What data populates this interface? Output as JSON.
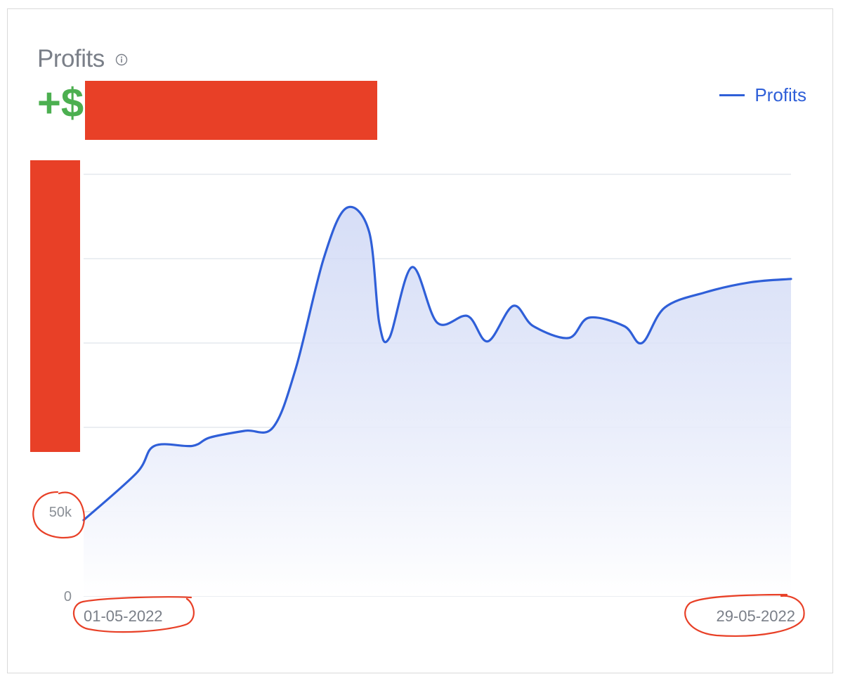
{
  "header": {
    "title": "Profits",
    "value_prefix": "+$",
    "info_icon": "info-icon"
  },
  "legend": {
    "label": "Profits"
  },
  "colors": {
    "line": "#2f5fd8",
    "fill_top": "#c9d3f4",
    "grid": "#dfe3ea",
    "value": "#4caf50",
    "annotation": "#e84027"
  },
  "chart_data": {
    "type": "area",
    "title": "",
    "xlabel": "",
    "ylabel": "",
    "ylim": [
      0,
      250000
    ],
    "y_ticks": [
      {
        "label": "0",
        "value": 0
      },
      {
        "label": "50k",
        "value": 50000
      }
    ],
    "grid_values": [
      0,
      50000,
      100000,
      150000,
      200000,
      250000
    ],
    "x_tick_labels": [
      "01-05-2022",
      "29-05-2022"
    ],
    "x_domain": [
      0,
      28
    ],
    "series": [
      {
        "name": "Profits",
        "points": [
          [
            0.0,
            45000
          ],
          [
            2.1,
            73000
          ],
          [
            2.8,
            89000
          ],
          [
            4.3,
            89000
          ],
          [
            5.0,
            94000
          ],
          [
            6.4,
            98000
          ],
          [
            7.5,
            100000
          ],
          [
            8.4,
            135000
          ],
          [
            9.5,
            200000
          ],
          [
            10.4,
            230000
          ],
          [
            11.3,
            216000
          ],
          [
            11.7,
            162000
          ],
          [
            12.1,
            153000
          ],
          [
            13.0,
            195000
          ],
          [
            14.0,
            162000
          ],
          [
            15.2,
            166000
          ],
          [
            16.0,
            151000
          ],
          [
            17.0,
            172000
          ],
          [
            17.8,
            160000
          ],
          [
            19.2,
            153000
          ],
          [
            20.0,
            165000
          ],
          [
            21.4,
            160000
          ],
          [
            22.1,
            150000
          ],
          [
            23.0,
            171000
          ],
          [
            24.6,
            180000
          ],
          [
            26.4,
            186000
          ],
          [
            28.0,
            188000
          ]
        ]
      }
    ]
  }
}
